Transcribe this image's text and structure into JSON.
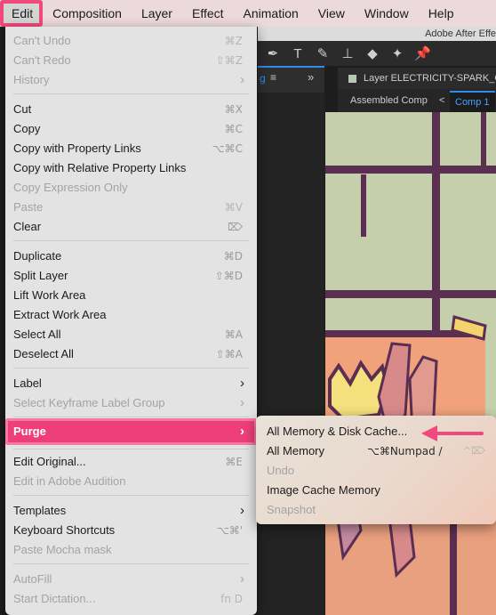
{
  "menubar": {
    "items": [
      "Edit",
      "Composition",
      "Layer",
      "Effect",
      "Animation",
      "View",
      "Window",
      "Help"
    ]
  },
  "app": {
    "title": "Adobe After Effe",
    "panel_tab_text": "g",
    "panel_tab_menu": "≡",
    "panel_chevron": "»",
    "layer_header": "Layer ELECTRICITY-SPARK_GE",
    "comp_breadcrumb": "Assembled Comp",
    "comp_nav_arrow": "<",
    "comp_active_tab": "Comp 1"
  },
  "edit_menu": {
    "cant_undo": {
      "label": "Can't Undo",
      "shortcut": "⌘Z"
    },
    "cant_redo": {
      "label": "Can't Redo",
      "shortcut": "⇧⌘Z"
    },
    "history": {
      "label": "History"
    },
    "cut": {
      "label": "Cut",
      "shortcut": "⌘X"
    },
    "copy": {
      "label": "Copy",
      "shortcut": "⌘C"
    },
    "copy_with_property_links": {
      "label": "Copy with Property Links",
      "shortcut": "⌥⌘C"
    },
    "copy_with_relative_property_links": {
      "label": "Copy with Relative Property Links"
    },
    "copy_expression_only": {
      "label": "Copy Expression Only"
    },
    "paste": {
      "label": "Paste",
      "shortcut": "⌘V"
    },
    "clear": {
      "label": "Clear",
      "shortcut": "⌦"
    },
    "duplicate": {
      "label": "Duplicate",
      "shortcut": "⌘D"
    },
    "split_layer": {
      "label": "Split Layer",
      "shortcut": "⇧⌘D"
    },
    "lift_work_area": {
      "label": "Lift Work Area"
    },
    "extract_work_area": {
      "label": "Extract Work Area"
    },
    "select_all": {
      "label": "Select All",
      "shortcut": "⌘A"
    },
    "deselect_all": {
      "label": "Deselect All",
      "shortcut": "⇧⌘A"
    },
    "label": {
      "label": "Label"
    },
    "select_keyframe_label_group": {
      "label": "Select Keyframe Label Group"
    },
    "purge": {
      "label": "Purge"
    },
    "edit_original": {
      "label": "Edit Original...",
      "shortcut": "⌘E"
    },
    "edit_in_adobe_audition": {
      "label": "Edit in Adobe Audition"
    },
    "templates": {
      "label": "Templates"
    },
    "keyboard_shortcuts": {
      "label": "Keyboard Shortcuts",
      "shortcut": "⌥⌘'"
    },
    "paste_mocha_mask": {
      "label": "Paste Mocha mask"
    },
    "autofill": {
      "label": "AutoFill"
    },
    "start_dictation": {
      "label": "Start Dictation...",
      "shortcut": "fn D"
    },
    "submenu_arrow": "›"
  },
  "purge_submenu": {
    "all_memory_disk_cache": {
      "label": "All Memory & Disk Cache..."
    },
    "all_memory": {
      "label": "All Memory",
      "shortcut": "⌥⌘Numpad /"
    },
    "undo": {
      "label": "Undo",
      "shortcut": "^⌦"
    },
    "image_cache_memory": {
      "label": "Image Cache Memory"
    },
    "snapshot": {
      "label": "Snapshot"
    }
  },
  "colors": {
    "highlight": "#ee3f7a",
    "callout_arrow": "#f0497b",
    "accent_blue": "#2d8ceb"
  },
  "icons": {
    "toolbar": [
      "pen-icon",
      "type-icon",
      "brush-icon",
      "clone-stamp-icon",
      "eraser-icon",
      "roto-brush-icon",
      "puppet-pin-icon"
    ]
  }
}
